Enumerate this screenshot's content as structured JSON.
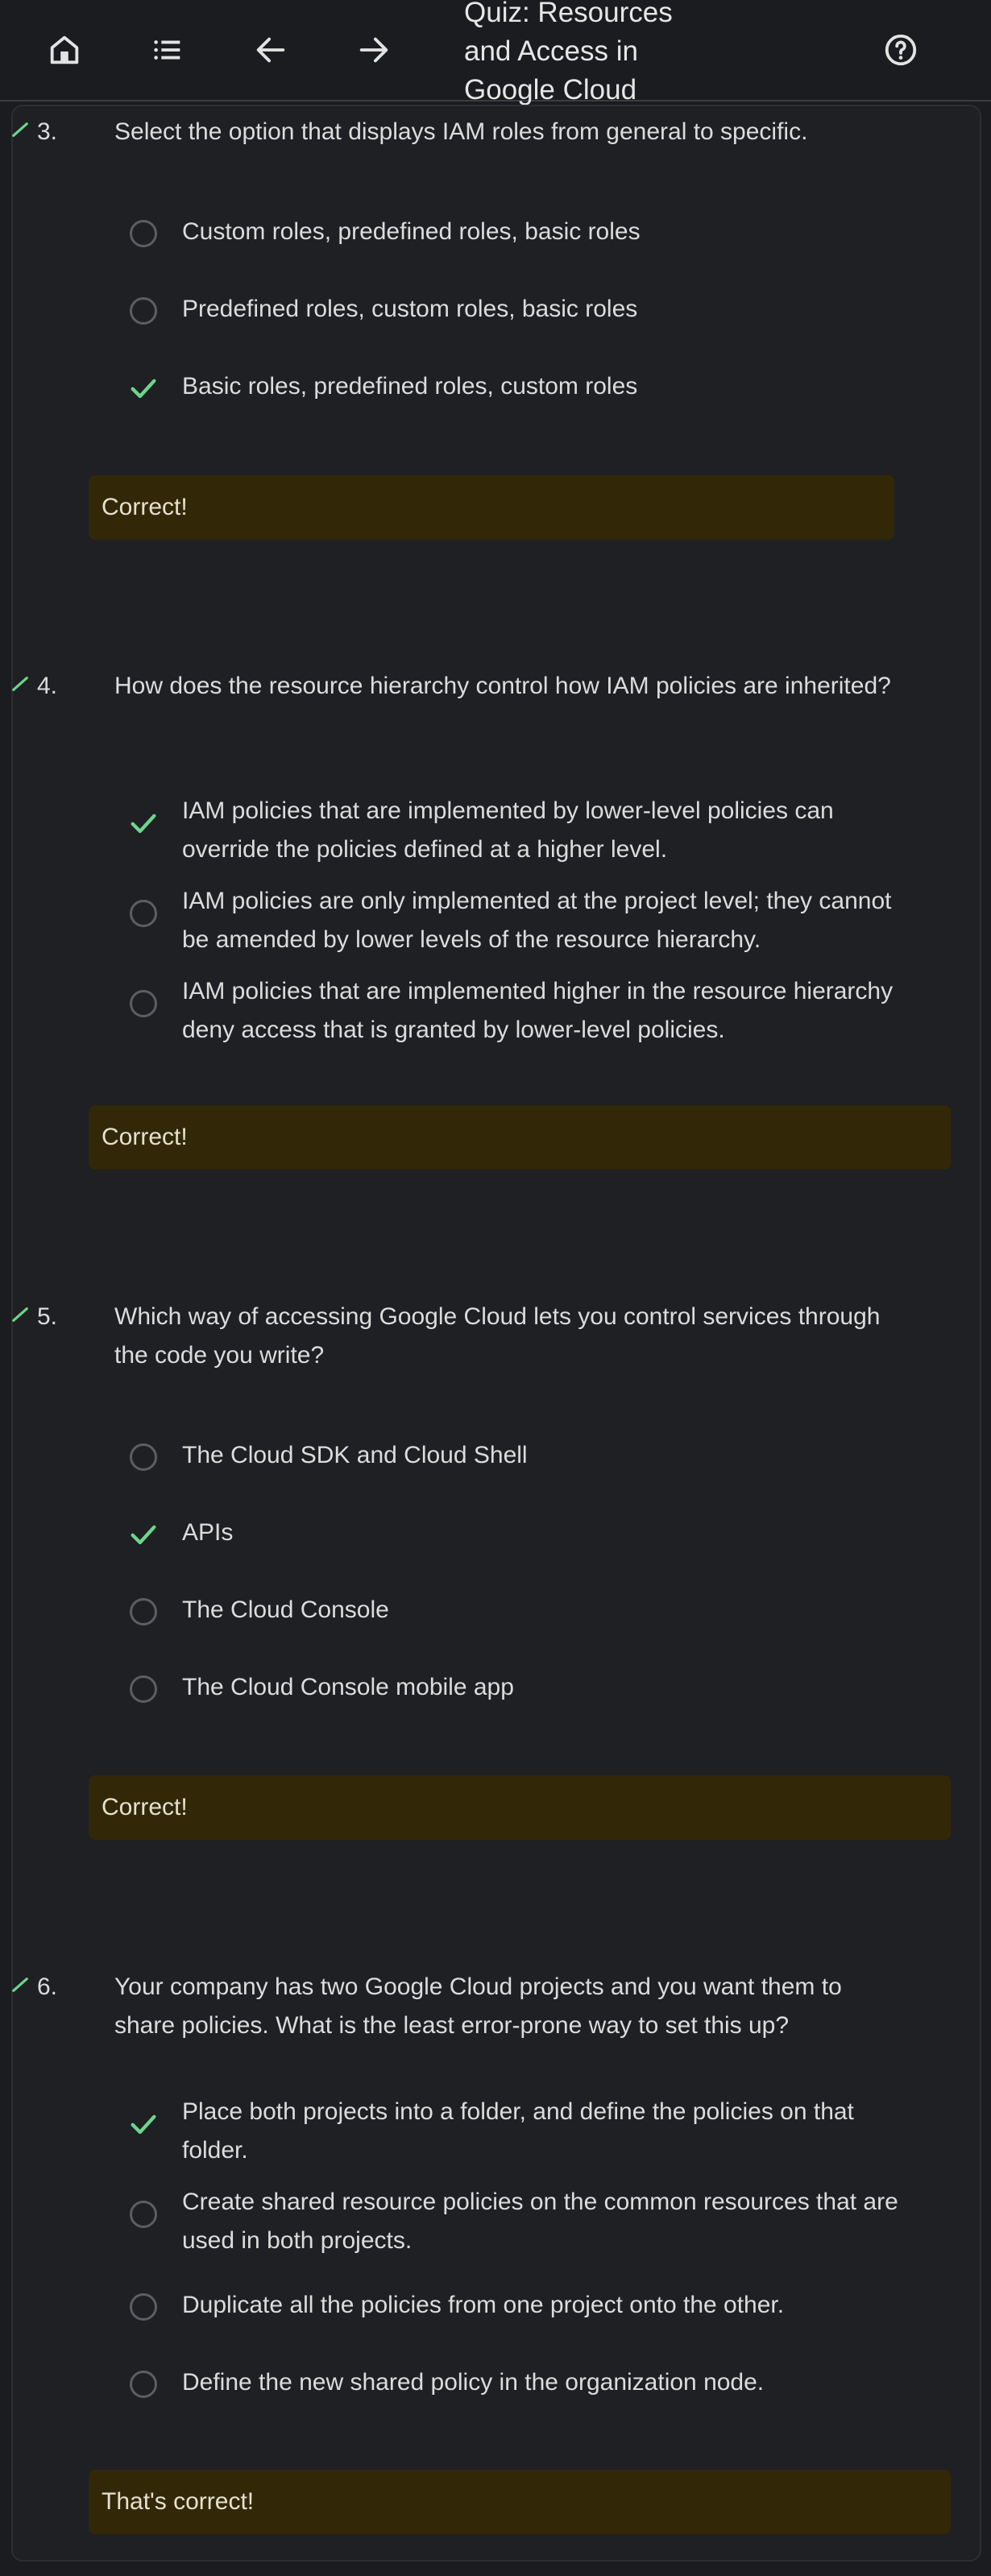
{
  "header": {
    "title": "Quiz: Resources and Access in Google Cloud",
    "icons": [
      "home-icon",
      "list-icon",
      "arrow-back-icon",
      "arrow-forward-icon",
      "help-icon"
    ]
  },
  "colors": {
    "background": "#1b1c1f",
    "correct_check": "#6dd58c",
    "feedback_bg": "#322808",
    "radio_border": "#5c5e63"
  },
  "questions": [
    {
      "number": "3.",
      "text": "Select the option that displays IAM roles from general to specific.",
      "options": [
        {
          "label": "Custom roles, predefined roles, basic roles",
          "state": "unselected"
        },
        {
          "label": "Predefined roles, custom roles, basic roles",
          "state": "unselected"
        },
        {
          "label": "Basic roles, predefined roles, custom roles",
          "state": "correct"
        }
      ],
      "feedback": "Correct!"
    },
    {
      "number": "4.",
      "text": "How does the resource hierarchy control how IAM policies are inherited?",
      "options": [
        {
          "label": "IAM policies that are implemented by lower-level policies can override the policies defined at a higher level.",
          "state": "correct"
        },
        {
          "label": "IAM policies are only implemented at the project level; they cannot be amended by lower levels of the resource hierarchy.",
          "state": "unselected"
        },
        {
          "label": "IAM policies that are implemented higher in the resource hierarchy deny access that is granted by lower-level policies.",
          "state": "unselected"
        }
      ],
      "feedback": "Correct!"
    },
    {
      "number": "5.",
      "text": "Which way of accessing Google Cloud lets you control services through the code you write?",
      "options": [
        {
          "label": "The Cloud SDK and Cloud Shell",
          "state": "unselected"
        },
        {
          "label": "APIs",
          "state": "correct"
        },
        {
          "label": "The Cloud Console",
          "state": "unselected"
        },
        {
          "label": "The Cloud Console mobile app",
          "state": "unselected"
        }
      ],
      "feedback": "Correct!"
    },
    {
      "number": "6.",
      "text": "Your company has two Google Cloud projects and you want them to share policies. What is the least error-prone way to set this up?",
      "options": [
        {
          "label": "Place both projects into a folder, and define the policies on that folder.",
          "state": "correct"
        },
        {
          "label": "Create shared resource policies on the common resources that are used in both projects.",
          "state": "unselected"
        },
        {
          "label": "Duplicate all the policies from one project onto the other.",
          "state": "unselected"
        },
        {
          "label": "Define the new shared policy in the organization node.",
          "state": "unselected"
        }
      ],
      "feedback": "That's correct!"
    }
  ]
}
